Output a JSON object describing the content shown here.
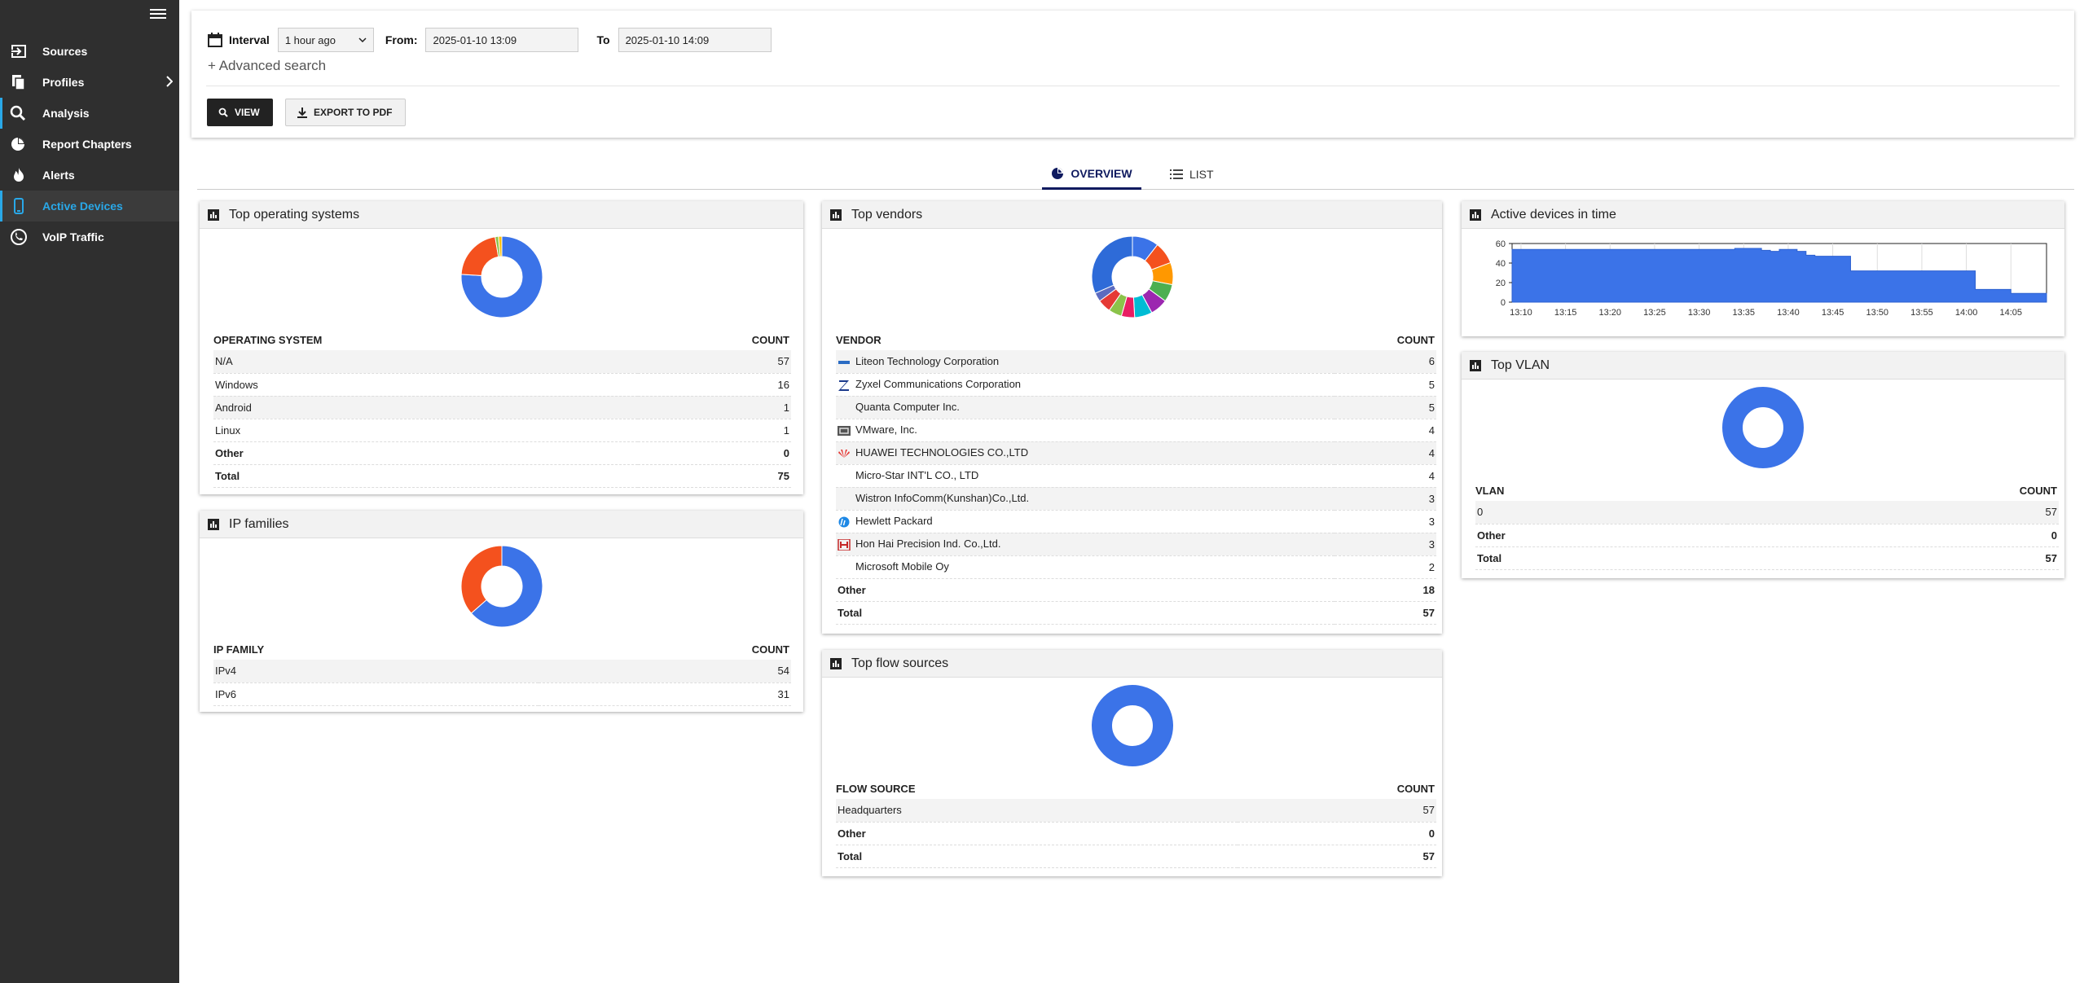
{
  "sidebar": {
    "items": [
      {
        "label": "Sources",
        "icon": "login-icon"
      },
      {
        "label": "Profiles",
        "icon": "documents-icon"
      },
      {
        "label": "Analysis",
        "icon": "search-icon"
      },
      {
        "label": "Report Chapters",
        "icon": "pie-chart-icon"
      },
      {
        "label": "Alerts",
        "icon": "flame-icon"
      },
      {
        "label": "Active Devices",
        "icon": "phone-icon"
      },
      {
        "label": "VoIP Traffic",
        "icon": "voip-icon"
      }
    ]
  },
  "filter": {
    "interval_label": "Interval",
    "interval_value": "1 hour ago",
    "from_label": "From:",
    "from_value": "2025-01-10 13:09",
    "to_label": "To",
    "to_value": "2025-01-10 14:09",
    "advanced_search": "+  Advanced search",
    "view_button": "VIEW",
    "export_button": "EXPORT TO PDF"
  },
  "tabs": {
    "overview": "OVERVIEW",
    "list": "LIST"
  },
  "colors": {
    "accent": "#29a8e8",
    "blue": "#3b73e8",
    "orange": "#f4511e",
    "navy": "#0f1a5f"
  },
  "panels": {
    "os": {
      "title": "Top operating systems",
      "col1": "OPERATING SYSTEM",
      "col2": "COUNT",
      "rows": [
        {
          "name": "N/A",
          "count": "57"
        },
        {
          "name": "Windows",
          "count": "16"
        },
        {
          "name": "Android",
          "count": "1"
        },
        {
          "name": "Linux",
          "count": "1"
        }
      ],
      "other": {
        "name": "Other",
        "count": "0"
      },
      "total": {
        "name": "Total",
        "count": "75"
      }
    },
    "ip": {
      "title": "IP families",
      "col1": "IP FAMILY",
      "col2": "COUNT",
      "rows": [
        {
          "name": "IPv4",
          "count": "54"
        },
        {
          "name": "IPv6",
          "count": "31"
        }
      ]
    },
    "vendors": {
      "title": "Top vendors",
      "col1": "VENDOR",
      "col2": "COUNT",
      "rows": [
        {
          "name": "Liteon Technology Corporation",
          "count": "6",
          "icon": "liteon-logo-icon"
        },
        {
          "name": "Zyxel Communications Corporation",
          "count": "5",
          "icon": "zyxel-logo-icon"
        },
        {
          "name": "Quanta Computer Inc.",
          "count": "5",
          "icon": ""
        },
        {
          "name": "VMware, Inc.",
          "count": "4",
          "icon": "vmware-logo-icon"
        },
        {
          "name": "HUAWEI TECHNOLOGIES CO.,LTD",
          "count": "4",
          "icon": "huawei-logo-icon"
        },
        {
          "name": "Micro-Star INT'L CO., LTD",
          "count": "4",
          "icon": ""
        },
        {
          "name": "Wistron InfoComm(Kunshan)Co.,Ltd.",
          "count": "3",
          "icon": ""
        },
        {
          "name": "Hewlett Packard",
          "count": "3",
          "icon": "hp-logo-icon"
        },
        {
          "name": "Hon Hai Precision Ind. Co.,Ltd.",
          "count": "3",
          "icon": "honhai-logo-icon"
        },
        {
          "name": "Microsoft Mobile Oy",
          "count": "2",
          "icon": ""
        }
      ],
      "other": {
        "name": "Other",
        "count": "18"
      },
      "total": {
        "name": "Total",
        "count": "57"
      }
    },
    "flow": {
      "title": "Top flow sources",
      "col1": "FLOW SOURCE",
      "col2": "COUNT",
      "rows": [
        {
          "name": "Headquarters",
          "count": "57"
        }
      ],
      "other": {
        "name": "Other",
        "count": "0"
      },
      "total": {
        "name": "Total",
        "count": "57"
      }
    },
    "timeline": {
      "title": "Active devices in time"
    },
    "vlan": {
      "title": "Top VLAN",
      "col1": "VLAN",
      "col2": "COUNT",
      "rows": [
        {
          "name": "0",
          "count": "57"
        }
      ],
      "other": {
        "name": "Other",
        "count": "0"
      },
      "total": {
        "name": "Total",
        "count": "57"
      }
    }
  },
  "chart_data": [
    {
      "type": "pie",
      "id": "os-donut",
      "labels": [
        "N/A",
        "Windows",
        "Android",
        "Linux"
      ],
      "values": [
        57,
        16,
        1,
        1
      ],
      "colors": [
        "#3b73e8",
        "#f4511e",
        "#8bc34a",
        "#ffc107"
      ]
    },
    {
      "type": "pie",
      "id": "ip-donut",
      "labels": [
        "IPv4",
        "IPv6"
      ],
      "values": [
        54,
        31
      ],
      "colors": [
        "#3b73e8",
        "#f4511e"
      ]
    },
    {
      "type": "pie",
      "id": "vendors-donut",
      "labels": [
        "Liteon Technology Corporation",
        "Zyxel Communications Corporation",
        "Quanta Computer Inc.",
        "VMware, Inc.",
        "HUAWEI TECHNOLOGIES CO.,LTD",
        "Micro-Star INT'L CO., LTD",
        "Wistron InfoComm(Kunshan)Co.,Ltd.",
        "Hewlett Packard",
        "Hon Hai Precision Ind. Co.,Ltd.",
        "Microsoft Mobile Oy",
        "Other"
      ],
      "values": [
        6,
        5,
        5,
        4,
        4,
        4,
        3,
        3,
        3,
        2,
        18
      ],
      "colors": [
        "#3b73e8",
        "#f4511e",
        "#ff9800",
        "#4caf50",
        "#9c27b0",
        "#00bcd4",
        "#e91e63",
        "#8bc34a",
        "#e53935",
        "#5c6bc0",
        "#2e6bd8"
      ]
    },
    {
      "type": "pie",
      "id": "flow-donut",
      "labels": [
        "Headquarters"
      ],
      "values": [
        57
      ],
      "colors": [
        "#3b73e8"
      ]
    },
    {
      "type": "pie",
      "id": "vlan-donut",
      "labels": [
        "0"
      ],
      "values": [
        57
      ],
      "colors": [
        "#3b73e8"
      ]
    },
    {
      "type": "area",
      "id": "active-devices-chart",
      "x": [
        "13:09",
        "13:10",
        "13:11",
        "13:12",
        "13:13",
        "13:14",
        "13:15",
        "13:16",
        "13:17",
        "13:18",
        "13:19",
        "13:20",
        "13:21",
        "13:22",
        "13:23",
        "13:24",
        "13:25",
        "13:26",
        "13:27",
        "13:28",
        "13:29",
        "13:30",
        "13:31",
        "13:32",
        "13:33",
        "13:34",
        "13:35",
        "13:36",
        "13:37",
        "13:38",
        "13:39",
        "13:40",
        "13:41",
        "13:42",
        "13:43",
        "13:44",
        "13:45",
        "13:46",
        "13:47",
        "13:48",
        "13:49",
        "13:50",
        "13:51",
        "13:52",
        "13:53",
        "13:54",
        "13:55",
        "13:56",
        "13:57",
        "13:58",
        "13:59",
        "14:00",
        "14:01",
        "14:02",
        "14:03",
        "14:04",
        "14:05",
        "14:06",
        "14:07",
        "14:08",
        "14:09"
      ],
      "values": [
        54,
        54,
        54,
        54,
        54,
        54,
        54,
        54,
        54,
        54,
        54,
        54,
        54,
        54,
        54,
        54,
        54,
        54,
        54,
        54,
        54,
        54,
        54,
        54,
        54,
        55,
        55,
        55,
        53,
        52,
        54,
        54,
        52,
        48,
        47,
        47,
        47,
        47,
        32,
        32,
        32,
        32,
        32,
        32,
        32,
        32,
        32,
        32,
        32,
        32,
        32,
        32,
        13,
        13,
        13,
        13,
        9,
        9,
        9,
        9,
        9
      ],
      "xticks": [
        "13:10",
        "13:15",
        "13:20",
        "13:25",
        "13:30",
        "13:35",
        "13:40",
        "13:45",
        "13:50",
        "13:55",
        "14:00",
        "14:05"
      ],
      "yticks": [
        "0",
        "20",
        "40",
        "60"
      ],
      "ylim": [
        0,
        60
      ],
      "grid": true
    }
  ]
}
